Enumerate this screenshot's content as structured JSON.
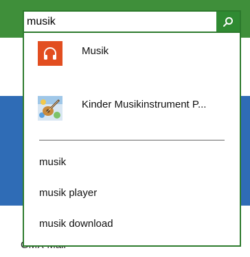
{
  "search": {
    "query": "musik",
    "button_icon": "search-icon"
  },
  "apps": [
    {
      "name": "Musik",
      "icon": "headphones-icon",
      "icon_color": "#e24e20"
    },
    {
      "name": "Kinder Musikinstrument P...",
      "icon": "guitar-icon"
    }
  ],
  "suggestions": [
    "musik",
    "musik player",
    "musik download"
  ],
  "background": {
    "partial_label": "GMX Mail"
  },
  "colors": {
    "header_green": "#3f8f3a",
    "border_green": "#2c7a2c",
    "tile_blue": "#2f6cb6"
  }
}
